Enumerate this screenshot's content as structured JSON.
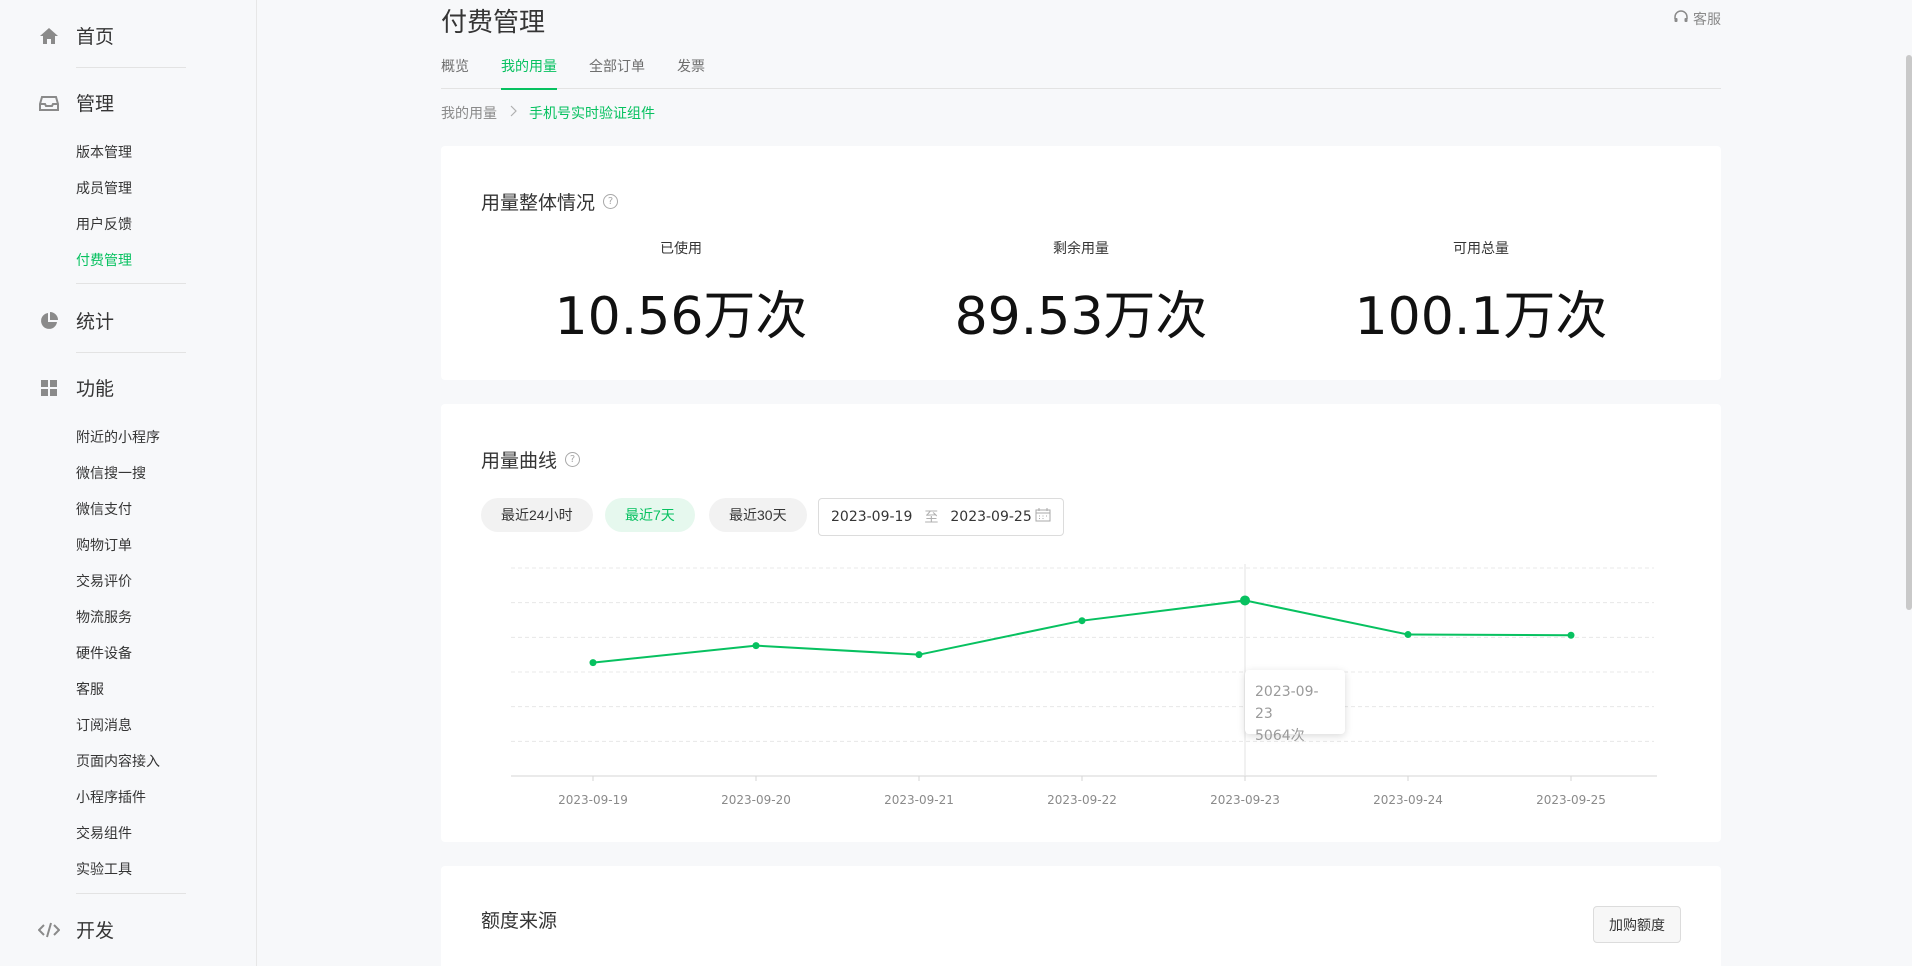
{
  "sidebar": {
    "groups": [
      {
        "label": "首页",
        "icon": "home-icon"
      },
      {
        "label": "管理",
        "icon": "inbox-icon"
      },
      {
        "label": "统计",
        "icon": "pie-chart-icon"
      },
      {
        "label": "功能",
        "icon": "grid-icon"
      },
      {
        "label": "开发",
        "icon": "code-icon"
      }
    ],
    "manage_items": [
      "版本管理",
      "成员管理",
      "用户反馈",
      "付费管理"
    ],
    "active_item": "付费管理",
    "feature_items": [
      "附近的小程序",
      "微信搜一搜",
      "微信支付",
      "购物订单",
      "交易评价",
      "物流服务",
      "硬件设备",
      "客服",
      "订阅消息",
      "页面内容接入",
      "小程序插件",
      "交易组件",
      "实验工具"
    ]
  },
  "header": {
    "title": "付费管理",
    "service": "客服",
    "tabs": [
      "概览",
      "我的用量",
      "全部订单",
      "发票"
    ],
    "active_tab": "我的用量"
  },
  "breadcrumb": {
    "parent": "我的用量",
    "current": "手机号实时验证组件"
  },
  "overview": {
    "title": "用量整体情况",
    "stats": [
      {
        "label": "已使用",
        "value": "10.56万次"
      },
      {
        "label": "剩余用量",
        "value": "89.53万次"
      },
      {
        "label": "可用总量",
        "value": "100.1万次"
      }
    ]
  },
  "curve": {
    "title": "用量曲线",
    "ranges": [
      "最近24小时",
      "最近7天",
      "最近30天"
    ],
    "active_range": "最近7天",
    "date_start": "2023-09-19",
    "date_sep": "至",
    "date_end": "2023-09-25",
    "tooltip": {
      "date": "2023-09-23",
      "value": "5064次"
    }
  },
  "chart_data": {
    "type": "line",
    "x": [
      "2023-09-19",
      "2023-09-20",
      "2023-09-21",
      "2023-09-22",
      "2023-09-23",
      "2023-09-24",
      "2023-09-25"
    ],
    "values": [
      3270,
      3760,
      3500,
      4480,
      5064,
      4080,
      4060
    ],
    "ylim": [
      0,
      6000
    ],
    "grid": true,
    "highlight_index": 4,
    "color": "#07c160"
  },
  "source": {
    "title": "额度来源",
    "buy_button": "加购额度"
  }
}
